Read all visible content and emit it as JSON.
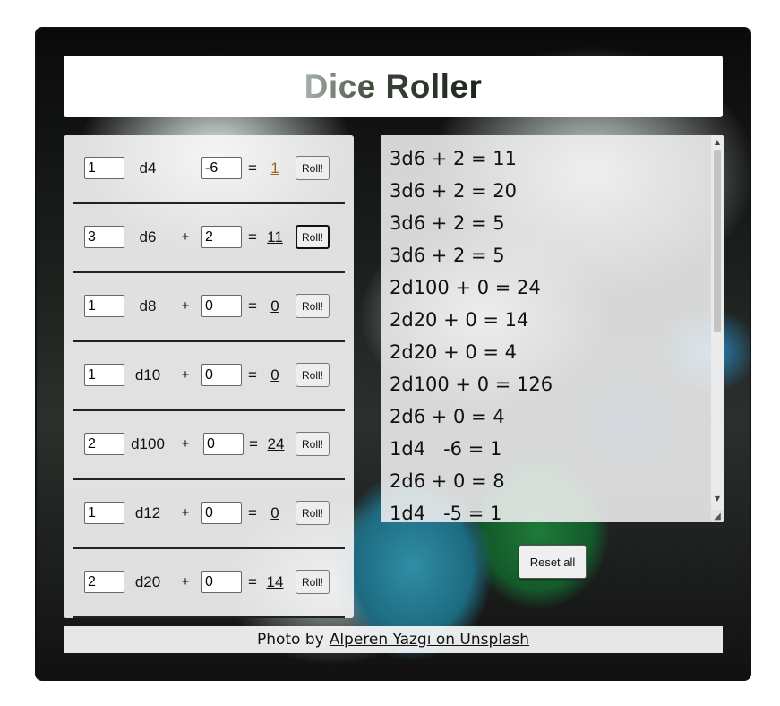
{
  "title": "Dice Roller",
  "dice": [
    {
      "count": "1",
      "die": "d4",
      "sign": "",
      "modifier": "-6",
      "result": "1",
      "roll_label": "Roll!"
    },
    {
      "count": "3",
      "die": "d6",
      "sign": "+",
      "modifier": "2",
      "result": "11",
      "roll_label": "Roll!"
    },
    {
      "count": "1",
      "die": "d8",
      "sign": "+",
      "modifier": "0",
      "result": "0",
      "roll_label": "Roll!"
    },
    {
      "count": "1",
      "die": "d10",
      "sign": "+",
      "modifier": "0",
      "result": "0",
      "roll_label": "Roll!"
    },
    {
      "count": "2",
      "die": "d100",
      "sign": "+",
      "modifier": "0",
      "result": "24",
      "roll_label": "Roll!"
    },
    {
      "count": "1",
      "die": "d12",
      "sign": "+",
      "modifier": "0",
      "result": "0",
      "roll_label": "Roll!"
    },
    {
      "count": "2",
      "die": "d20",
      "sign": "+",
      "modifier": "0",
      "result": "14",
      "roll_label": "Roll!"
    }
  ],
  "equals": "=",
  "history": [
    "3d6 + 2 = 11",
    "3d6 + 2 = 20",
    "3d6 + 2 = 5",
    "3d6 + 2 = 5",
    "2d100 + 0 = 24",
    "2d20 + 0 = 14",
    "2d20 + 0 = 4",
    "2d100 + 0 = 126",
    "2d6 + 0 = 4",
    "1d4   -6 = 1",
    "2d6 + 0 = 8",
    "1d4   -5 = 1"
  ],
  "reset_label": "Reset all",
  "credit": {
    "prefix": "Photo by",
    "link_text": "Alperen Yazgı on Unsplash"
  },
  "colors": {
    "highlight_result": "#a0661a",
    "panel_bg": "#f5f5f5"
  }
}
